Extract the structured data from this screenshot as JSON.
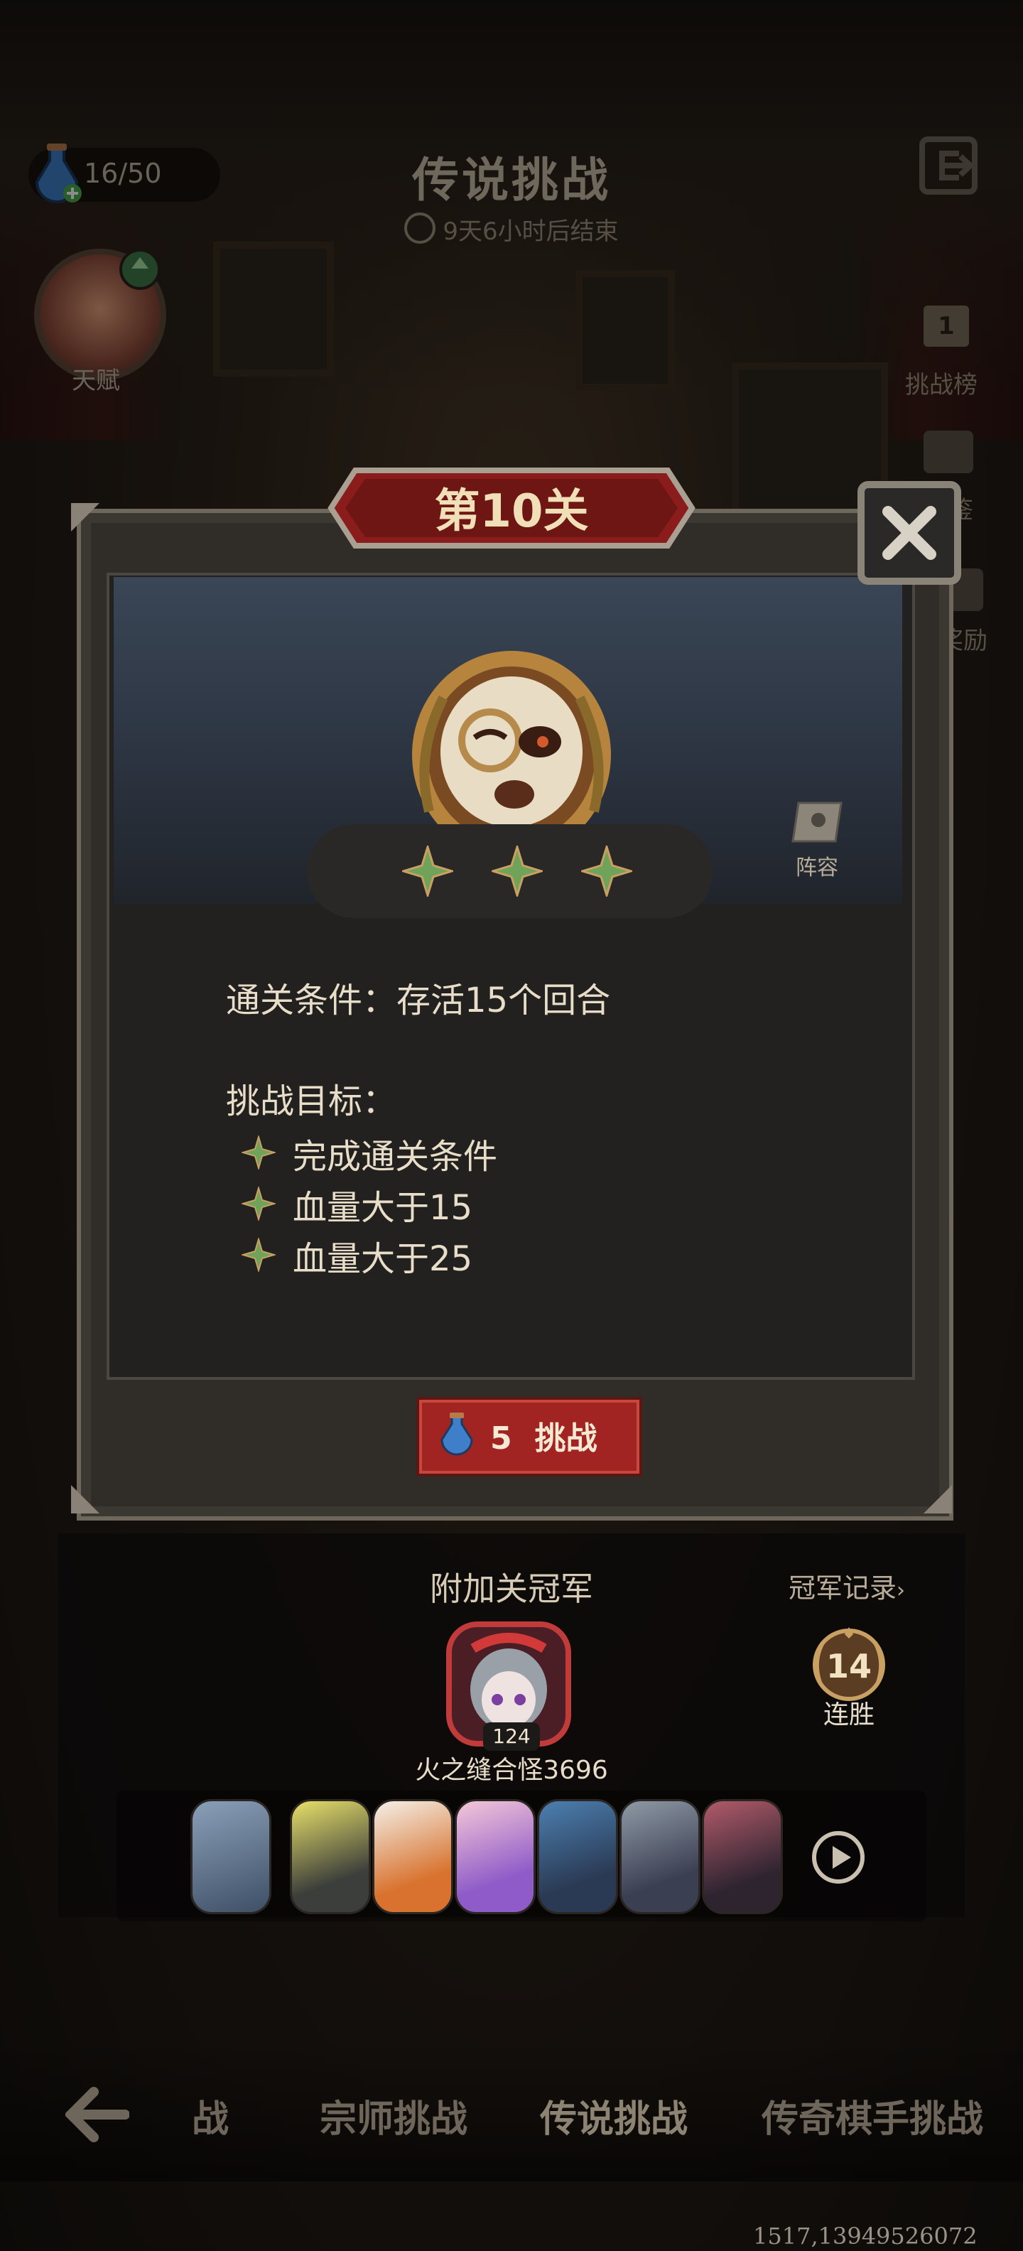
{
  "header": {
    "energy": "16/50",
    "title": "传说挑战",
    "timer": "9天6小时后结束"
  },
  "talent": {
    "label": "天赋"
  },
  "side_menu": {
    "leaderboard": {
      "badge": "1",
      "label": "挑战榜"
    },
    "second": "鉴",
    "reward": "奖励"
  },
  "modal": {
    "stage_title": "第10关",
    "lineup_label": "阵容",
    "clear_condition": "通关条件：存活15个回合",
    "goals_title": "挑战目标：",
    "goals": [
      "完成通关条件",
      "血量大于15",
      "血量大于25"
    ],
    "challenge_cost": "5",
    "challenge_label": "挑战",
    "stars": 3
  },
  "champion": {
    "title": "附加关冠军",
    "record_link": "冠军记录",
    "level": "124",
    "name": "火之缝合怪3696",
    "streak_num": "14",
    "streak_label": "连胜"
  },
  "nav": {
    "tabs": [
      "挑战",
      "宗师挑战",
      "传说挑战",
      "传奇棋手挑战"
    ],
    "active": "传说挑战"
  },
  "coords": "1517,1394",
  "id_number": "9526072",
  "colors": {
    "accent_red": "#a12422",
    "star_green": "#6fa35a",
    "gold": "#c9a062"
  }
}
